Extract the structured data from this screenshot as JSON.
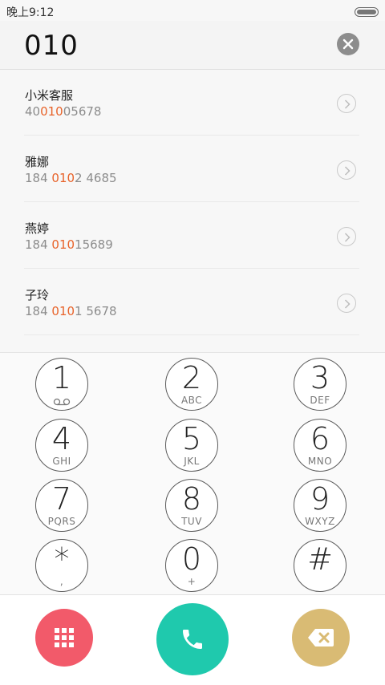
{
  "status_bar": {
    "time": "晚上9:12"
  },
  "input": {
    "value": "010"
  },
  "results": [
    {
      "name": "小米客服",
      "pre": "40",
      "match": "010",
      "post": "05678"
    },
    {
      "name": "雅娜",
      "pre": "184 ",
      "match": "010",
      "post": "2 4685"
    },
    {
      "name": "燕婷",
      "pre": "184 ",
      "match": "010",
      "post": "15689"
    },
    {
      "name": "子玲",
      "pre": "184 ",
      "match": "010",
      "post": "1 5678"
    }
  ],
  "keys": [
    {
      "digit": "1",
      "letters": "",
      "icon": "voicemail-icon"
    },
    {
      "digit": "2",
      "letters": "ABC"
    },
    {
      "digit": "3",
      "letters": "DEF"
    },
    {
      "digit": "4",
      "letters": "GHI"
    },
    {
      "digit": "5",
      "letters": "JKL"
    },
    {
      "digit": "6",
      "letters": "MNO"
    },
    {
      "digit": "7",
      "letters": "PQRS"
    },
    {
      "digit": "8",
      "letters": "TUV"
    },
    {
      "digit": "9",
      "letters": "WXYZ"
    },
    {
      "digit": "*",
      "letters": ","
    },
    {
      "digit": "0",
      "letters": "+"
    },
    {
      "digit": "#",
      "letters": ""
    }
  ],
  "actions": {
    "keypad_toggle": {
      "icon": "grid-icon",
      "color": "#f25a6a"
    },
    "call": {
      "icon": "phone-icon",
      "color": "#1fc9ad"
    },
    "backspace": {
      "icon": "backspace-icon",
      "color": "#d9bb74"
    }
  }
}
